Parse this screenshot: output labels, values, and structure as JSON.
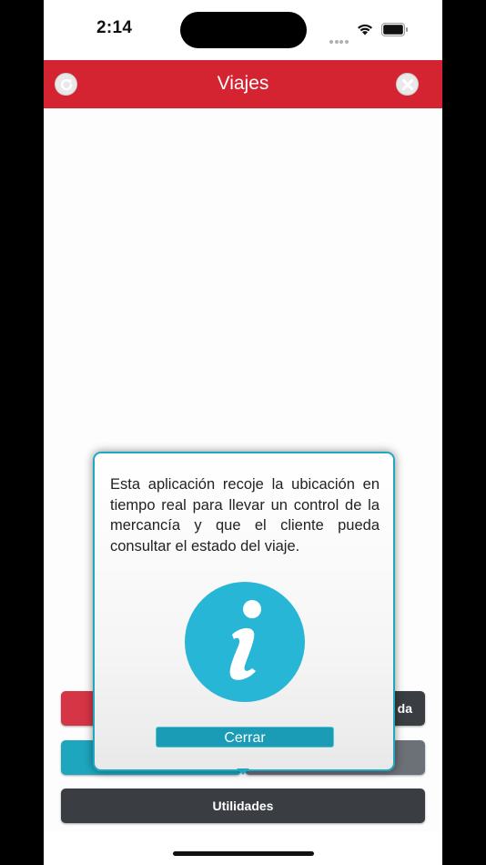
{
  "status_bar": {
    "time": "2:14"
  },
  "header": {
    "title": "Viajes",
    "color": "#d52431"
  },
  "buttons": {
    "top_right_partial": "da",
    "utilidades": "Utilidades"
  },
  "dialog": {
    "message": "Esta aplicación recoje la ubicación en tiempo real para llevar un control de la mercancía y que el cliente pueda consultar el estado del viaje.",
    "close_label": "Cerrar",
    "accent_color": "#1fa7bf",
    "icon": "info-icon"
  },
  "icons": {
    "refresh": "refresh-icon",
    "close": "close-icon",
    "wifi": "wifi-icon",
    "battery": "battery-icon"
  }
}
